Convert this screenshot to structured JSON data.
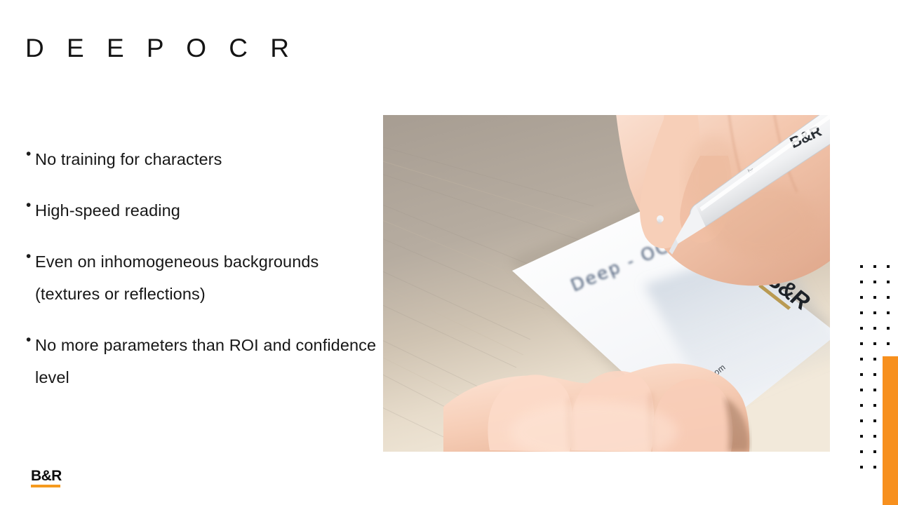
{
  "slide": {
    "title": "D E E P   O C R",
    "title_plain": "DEEP OCR",
    "background_color": "#ffffff",
    "accent_color": "#f7901e",
    "text_color": "#171717"
  },
  "bullets": [
    {
      "marker": "•",
      "text": "No training for characters"
    },
    {
      "marker": "•",
      "text": "High-speed reading"
    },
    {
      "marker": "•",
      "text": "Even on inhomogeneous backgrounds (textures or reflections)"
    },
    {
      "marker": "•",
      "text": "No more parameters than ROI and confidence level"
    }
  ],
  "photo": {
    "alt": "Hand writing on a white B&R business card with a white B&R pen on a wooden desk",
    "handwriting": "Deep - OC",
    "card_logo": "B&R",
    "card_url": "br-automation.com",
    "pen_logo": "B&R",
    "desk_color": "#b3a99d",
    "card_color": "#fdfdfd",
    "skin_color": "#f5cdb8"
  },
  "footer": {
    "logo_text": "B&R",
    "logo_bar_color": "#f59a1e"
  },
  "decoration": {
    "dot_color": "#111111",
    "dot_columns": 3,
    "dot_rows": 14,
    "bar_color": "#f7901e"
  }
}
